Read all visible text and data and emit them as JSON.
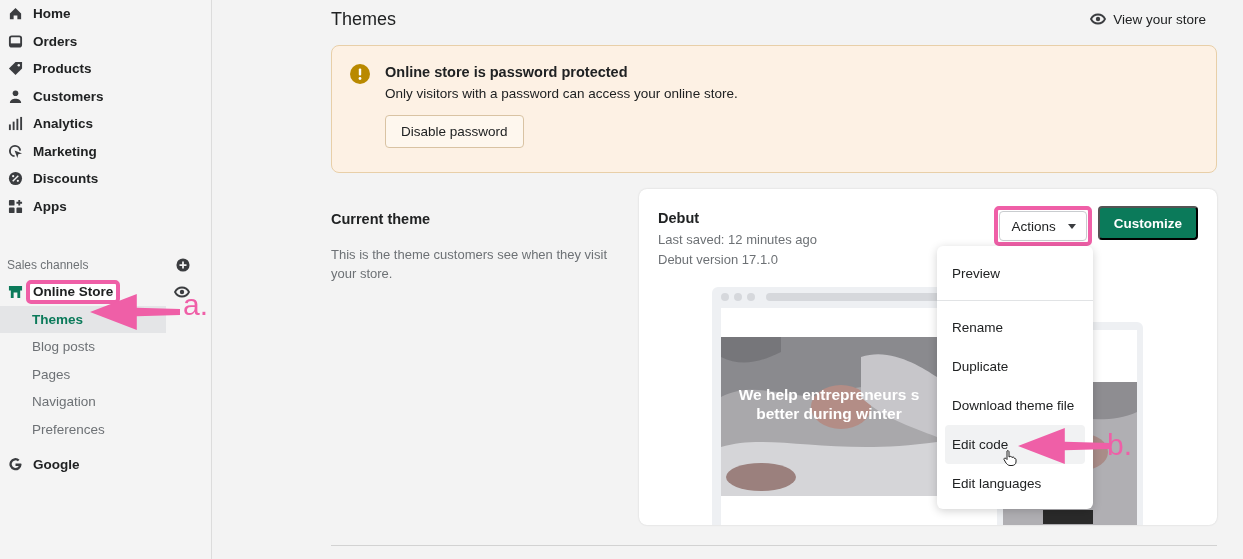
{
  "sidebar": {
    "items": [
      {
        "label": "Home"
      },
      {
        "label": "Orders"
      },
      {
        "label": "Products"
      },
      {
        "label": "Customers"
      },
      {
        "label": "Analytics"
      },
      {
        "label": "Marketing"
      },
      {
        "label": "Discounts"
      },
      {
        "label": "Apps"
      }
    ],
    "section_heading": "Sales channels",
    "channels": [
      {
        "label": "Online Store",
        "children": [
          {
            "label": "Themes",
            "selected": true
          },
          {
            "label": "Blog posts",
            "selected": false
          },
          {
            "label": "Pages",
            "selected": false
          },
          {
            "label": "Navigation",
            "selected": false
          },
          {
            "label": "Preferences",
            "selected": false
          }
        ]
      },
      {
        "label": "Google"
      }
    ]
  },
  "page": {
    "title": "Themes",
    "view_store": "View your store"
  },
  "banner": {
    "title": "Online store is password protected",
    "text": "Only visitors with a password can access your online store.",
    "button": "Disable password"
  },
  "current_theme": {
    "heading": "Current theme",
    "description": "This is the theme customers see when they visit your store."
  },
  "theme_card": {
    "name": "Debut",
    "last_saved": "Last saved: 12 minutes ago",
    "version": "Debut version 17.1.0",
    "actions_button": "Actions",
    "customize_button": "Customize",
    "preview_headline": [
      "We help entrepreneurs s",
      "better during winter"
    ]
  },
  "actions_menu": {
    "items": [
      {
        "label": "Preview",
        "hovered": false
      },
      {
        "label": "Rename",
        "hovered": false
      },
      {
        "label": "Duplicate",
        "hovered": false
      },
      {
        "label": "Download theme file",
        "hovered": false
      },
      {
        "label": "Edit code",
        "hovered": true
      },
      {
        "label": "Edit languages",
        "hovered": false
      }
    ]
  },
  "annotations": [
    {
      "label": "a."
    },
    {
      "label": "b."
    }
  ]
}
